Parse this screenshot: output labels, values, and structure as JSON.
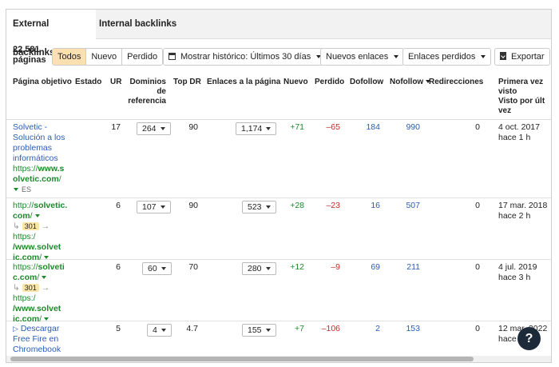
{
  "tabs": {
    "external": "External backlinks",
    "internal": "Internal backlinks"
  },
  "summary": {
    "count": "22,581",
    "unit": "páginas"
  },
  "filter": {
    "all": "Todos",
    "new": "Nuevo",
    "lost": "Perdido",
    "selected": "Todos"
  },
  "history_button": "Mostrar histórico: Últimos 30 días",
  "new_links_button": "Nuevos enlaces",
  "lost_links_button": "Enlaces perdidos",
  "export_button": "Exportar",
  "columns": {
    "target": "Página objetivo",
    "status": "Estado",
    "ur": "UR",
    "ref_domains_1": "Dominios",
    "ref_domains_2": "de",
    "ref_domains_3": "referencia",
    "top_dr": "Top DR",
    "links": "Enlaces a la página",
    "new": "Nuevo",
    "lost": "Perdido",
    "dofollow": "Dofollow",
    "nofollow": "Nofollow",
    "redirects": "Redirecciones",
    "first_seen_1": "Primera vez",
    "first_seen_2": "visto",
    "last_seen_1": "Visto por últ",
    "last_seen_2": "vez"
  },
  "rows": [
    {
      "title_1": "Solvetic -",
      "title_2": "Solución a los",
      "title_3": "problemas",
      "title_4": "informáticos",
      "url_a": "https://",
      "url_b": "www.s",
      "url_c": "olvetic.com",
      "url_d": "/",
      "lang": "ES",
      "ur": "17",
      "ref_domains": "264",
      "top_dr": "90",
      "links": "1,174",
      "new": "+71",
      "lost": "–65",
      "dofollow": "184",
      "nofollow": "990",
      "redirects": "0",
      "first_seen": "4 oct. 2017",
      "last_seen": "hace 1 h"
    },
    {
      "url_a": "http://",
      "url_b": "solvetic.",
      "url_c": "com",
      "url_d": "/",
      "redirect_code": "301",
      "redir_a": "https:/",
      "redir_b": "/www.solvet",
      "redir_c": "ic.com",
      "redir_d": "/",
      "ur": "6",
      "ref_domains": "107",
      "top_dr": "90",
      "links": "523",
      "new": "+28",
      "lost": "–23",
      "dofollow": "16",
      "nofollow": "507",
      "redirects": "0",
      "first_seen": "17 mar. 2018",
      "last_seen": "hace 2 h"
    },
    {
      "url_a": "https://",
      "url_b": "solveti",
      "url_c": "c.com",
      "url_d": "/",
      "redirect_code": "301",
      "redir_a": "https:/",
      "redir_b": "/www.solvet",
      "redir_c": "ic.com",
      "redir_d": "/",
      "ur": "6",
      "ref_domains": "60",
      "top_dr": "70",
      "links": "280",
      "new": "+12",
      "lost": "–9",
      "dofollow": "69",
      "nofollow": "211",
      "redirects": "0",
      "first_seen": "4 jul. 2019",
      "last_seen": "hace 3 h"
    },
    {
      "title_1": "Descargar",
      "title_2": "Free Fire en",
      "title_3": "Chromebook",
      "ur": "5",
      "ref_domains": "4",
      "top_dr": "4.7",
      "links": "155",
      "new": "+7",
      "lost": "–106",
      "dofollow": "2",
      "nofollow": "153",
      "redirects": "0",
      "first_seen": "12 mar. 2022",
      "last_seen": "hace"
    }
  ],
  "help_label": "?",
  "colors": {
    "accent": "#fde0b0",
    "link": "#2a5cb5",
    "green": "#1d8a2a",
    "red": "#c62828"
  }
}
